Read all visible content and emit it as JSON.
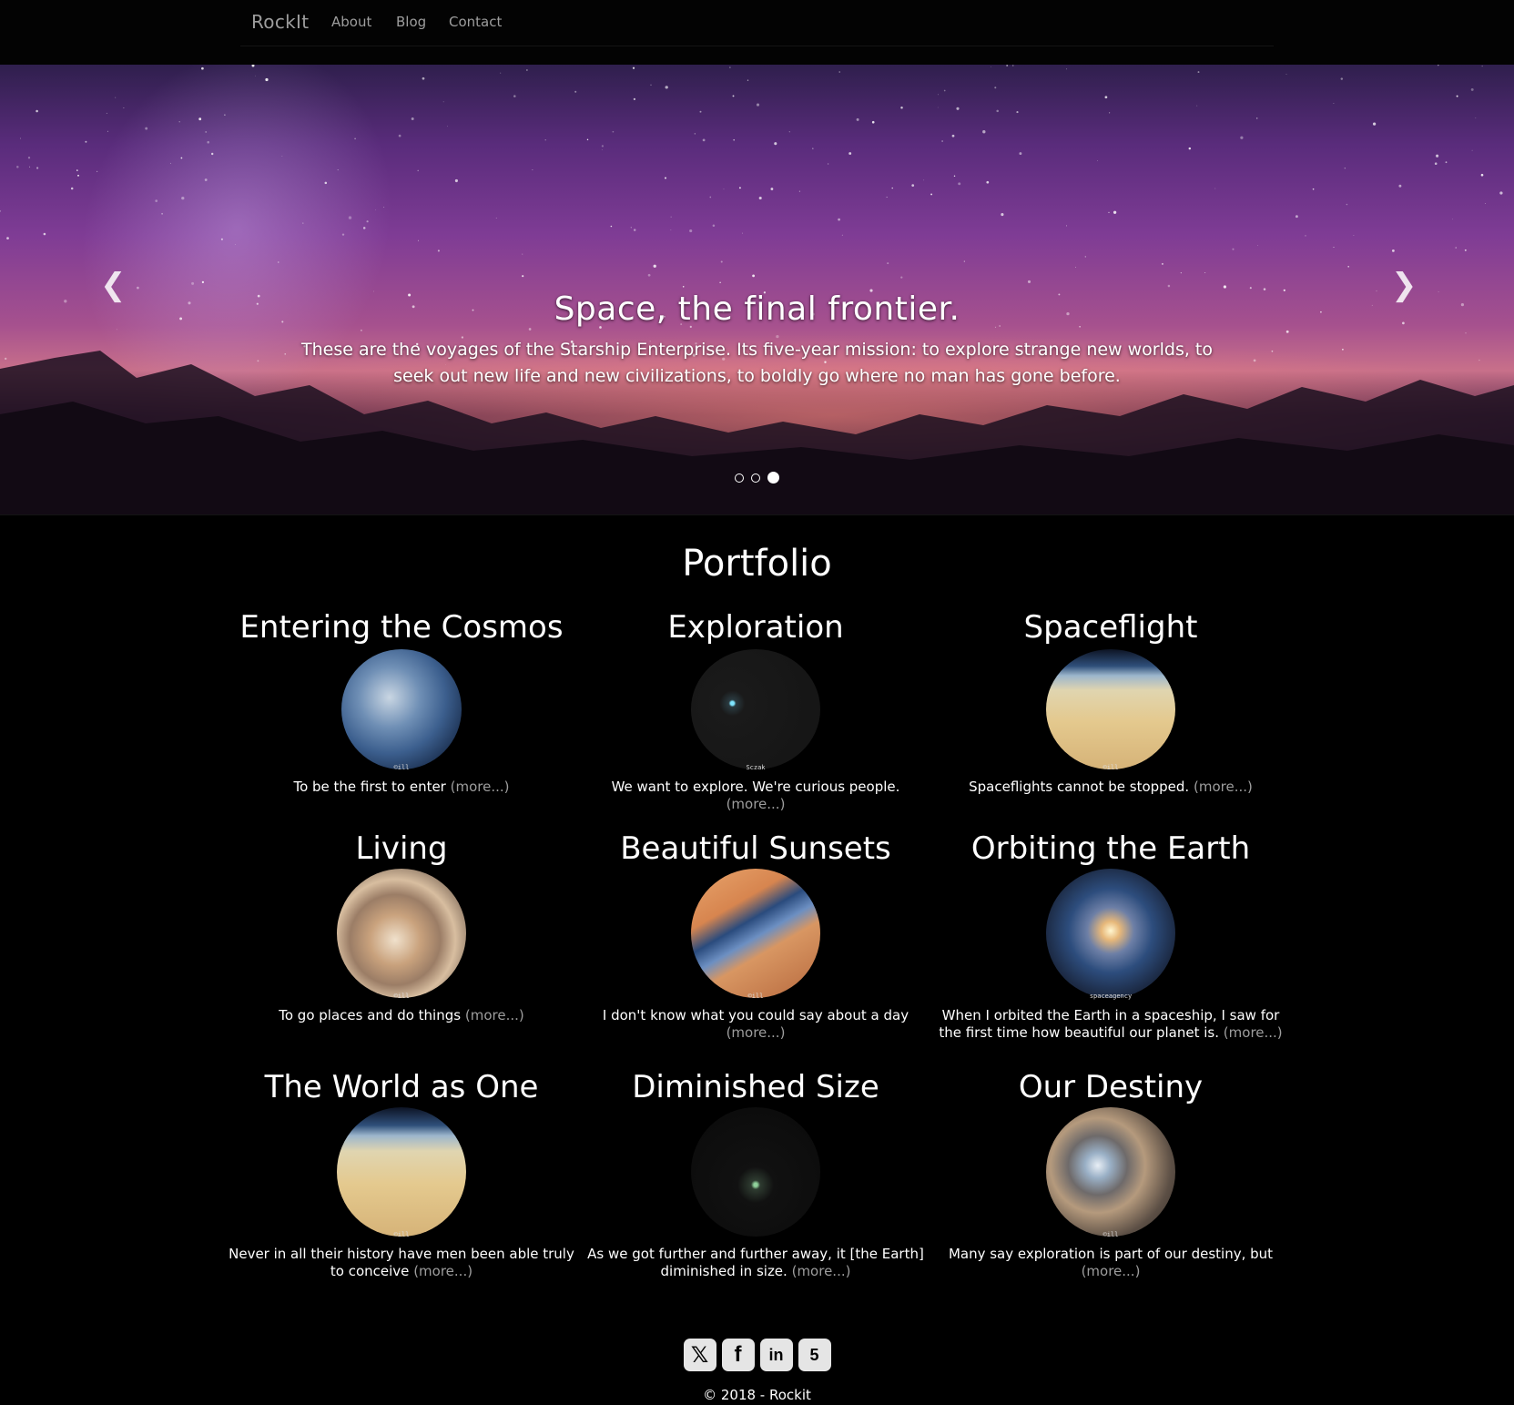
{
  "nav": {
    "brand": "RockIt",
    "links": [
      "About",
      "Blog",
      "Contact"
    ]
  },
  "carousel": {
    "title": "Space, the final frontier.",
    "text": "These are the voyages of the Starship Enterprise. Its five-year mission: to explore strange new worlds, to seek out new life and new civilizations, to boldly go where no man has gone before.",
    "prev_icon": "chevron-left-icon",
    "next_icon": "chevron-right-icon",
    "slide_count": 3,
    "active_slide": 3
  },
  "portfolio": {
    "title": "Portfolio",
    "more_label": "(more...)",
    "items": [
      {
        "title": "Entering the Cosmos",
        "text": "To be the first to enter",
        "image_tag": "©ill"
      },
      {
        "title": "Exploration",
        "text": "We want to explore. We're curious people.",
        "image_tag": "Sczak"
      },
      {
        "title": "Spaceflight",
        "text": "Spaceflights cannot be stopped.",
        "image_tag": "©ill"
      },
      {
        "title": "Living",
        "text": "To go places and do things",
        "image_tag": "©ill"
      },
      {
        "title": "Beautiful Sunsets",
        "text": "I don't know what you could say about a day",
        "image_tag": "©ill"
      },
      {
        "title": "Orbiting the Earth",
        "text": "When I orbited the Earth in a spaceship, I saw for the first time how beautiful our planet is.",
        "image_tag": "spaceagency"
      },
      {
        "title": "The World as One",
        "text": "Never in all their history have men been able truly to conceive",
        "image_tag": "©ill"
      },
      {
        "title": "Diminished Size",
        "text": "As we got further and further away, it [the Earth] diminished in size.",
        "image_tag": ""
      },
      {
        "title": "Our Destiny",
        "text": "Many say exploration is part of our destiny, but",
        "image_tag": "©ill"
      }
    ]
  },
  "footer": {
    "social": [
      "twitter-icon",
      "facebook-icon",
      "linkedin-icon",
      "html5-icon"
    ],
    "copyright": "© 2018 - Rockit"
  },
  "colors": {
    "background": "#000000",
    "navbar": "#030303",
    "nav_link": "#9d9d9d",
    "more_link": "#9d9d9d",
    "social_icon_bg": "#e5e5e5"
  }
}
